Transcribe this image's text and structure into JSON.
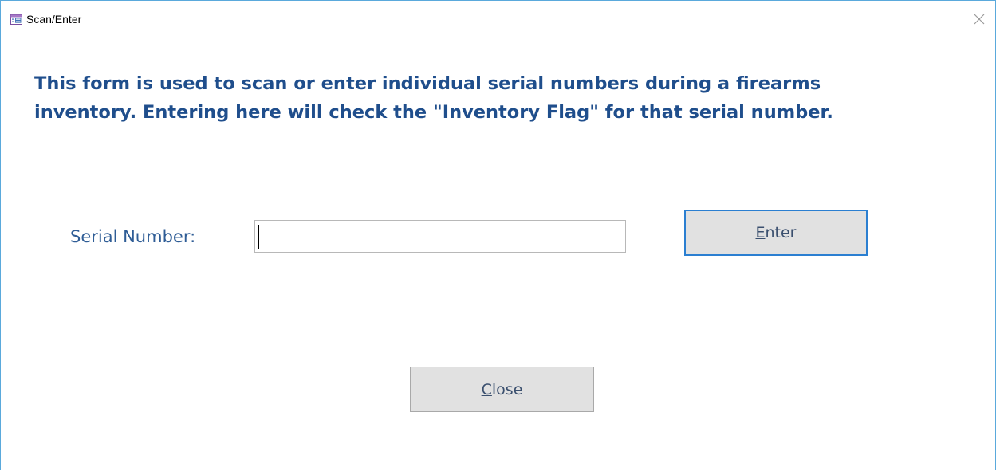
{
  "window": {
    "title": "Scan/Enter",
    "icon": "form-icon",
    "close_icon": "close-icon"
  },
  "instructions": "This form is used to scan or enter individual serial numbers during a firearms\ninventory.  Entering here will check the \"Inventory Flag\" for that serial number.",
  "serial": {
    "label": "Serial Number:",
    "value": "",
    "placeholder": ""
  },
  "buttons": {
    "enter": {
      "accel": "E",
      "rest": "nter"
    },
    "close": {
      "accel": "C",
      "rest": "lose"
    }
  },
  "colors": {
    "heading": "#1f4e8c",
    "label": "#2f5d96",
    "focus_border": "#2b7fd1",
    "window_border": "#5aa9dc",
    "button_face": "#e1e1e1"
  }
}
